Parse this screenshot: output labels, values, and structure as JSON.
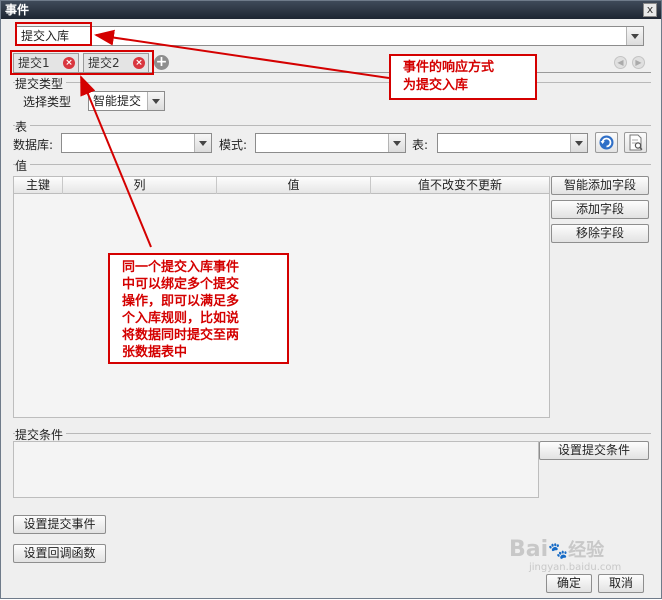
{
  "window": {
    "title": "事件",
    "close_glyph": "x"
  },
  "event_type": {
    "value": "提交入库"
  },
  "tabs": [
    {
      "label": "提交1",
      "close_glyph": "×"
    },
    {
      "label": "提交2",
      "close_glyph": "×"
    }
  ],
  "tab_add_glyph": "+",
  "submit_type": {
    "section_label": "提交类型",
    "select_label": "选择类型",
    "select_value": "智能提交"
  },
  "table_section": {
    "section_label": "表",
    "database_label": "数据库:",
    "database_value": "",
    "schema_label": "模式:",
    "schema_value": "",
    "table_label": "表:",
    "table_value": ""
  },
  "values_section": {
    "section_label": "值",
    "columns": [
      "主键",
      "列",
      "值",
      "值不改变不更新"
    ],
    "buttons": {
      "smart_add": "智能添加字段",
      "add": "添加字段",
      "remove": "移除字段"
    }
  },
  "condition_section": {
    "section_label": "提交条件",
    "set_button": "设置提交条件"
  },
  "bottom_buttons": {
    "set_submit_event": "设置提交事件",
    "set_callback": "设置回调函数",
    "ok": "确定",
    "cancel": "取消"
  },
  "annotations": {
    "callout_top": [
      "事件的响应方式",
      "为提交入库"
    ],
    "callout_middle": [
      "同一个提交入库事件",
      "中可以绑定多个提交",
      "操作，即可以满足多",
      "个入库规则，比如说",
      "将数据同时提交至两",
      "张数据表中"
    ]
  },
  "watermark": {
    "brand": "Bai",
    "brand2": "经验",
    "url": "jingyan.baidu.com"
  },
  "colors": {
    "annotation_red": "#d40000",
    "titlebar": "#1e2632",
    "refresh_icon": "#2f6fc7"
  }
}
